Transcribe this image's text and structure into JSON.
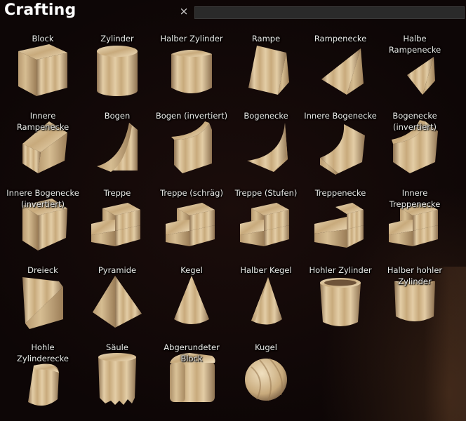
{
  "header": {
    "title": "Crafting",
    "clear_glyph": "×",
    "search_value": ""
  },
  "icons": {
    "clear": "close-icon"
  },
  "colors": {
    "wood_light": "#e3cda6",
    "wood_mid": "#c8aa7c",
    "wood_dark": "#8f7352"
  },
  "items": [
    {
      "label": "Block",
      "shape": "block"
    },
    {
      "label": "Zylinder",
      "shape": "cylinder"
    },
    {
      "label": "Halber Zylinder",
      "shape": "half-cylinder"
    },
    {
      "label": "Rampe",
      "shape": "ramp"
    },
    {
      "label": "Rampenecke",
      "shape": "ramp-corner"
    },
    {
      "label": "Halbe Rampenecke",
      "shape": "half-ramp-corner"
    },
    {
      "label": "Innere Rampenecke",
      "shape": "inner-ramp-corner"
    },
    {
      "label": "Bogen",
      "shape": "arch"
    },
    {
      "label": "Bogen (invertiert)",
      "shape": "arch-inverted"
    },
    {
      "label": "Bogenecke",
      "shape": "arch-corner"
    },
    {
      "label": "Innere Bogenecke",
      "shape": "inner-arch-corner"
    },
    {
      "label": "Bogenecke (invertiert)",
      "shape": "arch-corner-inverted"
    },
    {
      "label": "Innere Bogenecke (invertiert)",
      "shape": "inner-arch-corner-inverted"
    },
    {
      "label": "Treppe",
      "shape": "stairs"
    },
    {
      "label": "Treppe (schräg)",
      "shape": "stairs"
    },
    {
      "label": "Treppe (Stufen)",
      "shape": "stairs"
    },
    {
      "label": "Treppenecke",
      "shape": "stair-corner"
    },
    {
      "label": "Innere Treppenecke",
      "shape": "stairs"
    },
    {
      "label": "Dreieck",
      "shape": "triangle"
    },
    {
      "label": "Pyramide",
      "shape": "pyramid"
    },
    {
      "label": "Kegel",
      "shape": "cone"
    },
    {
      "label": "Halber Kegel",
      "shape": "half-cone"
    },
    {
      "label": "Hohler Zylinder",
      "shape": "hollow-cylinder"
    },
    {
      "label": "Halber hohler Zylinder",
      "shape": "half-hollow-cylinder"
    },
    {
      "label": "Hohle Zylinderecke",
      "shape": "hollow-cylinder-corner"
    },
    {
      "label": "Säule",
      "shape": "pillar"
    },
    {
      "label": "Abgerundeter Block",
      "shape": "rounded-block"
    },
    {
      "label": "Kugel",
      "shape": "sphere"
    }
  ]
}
